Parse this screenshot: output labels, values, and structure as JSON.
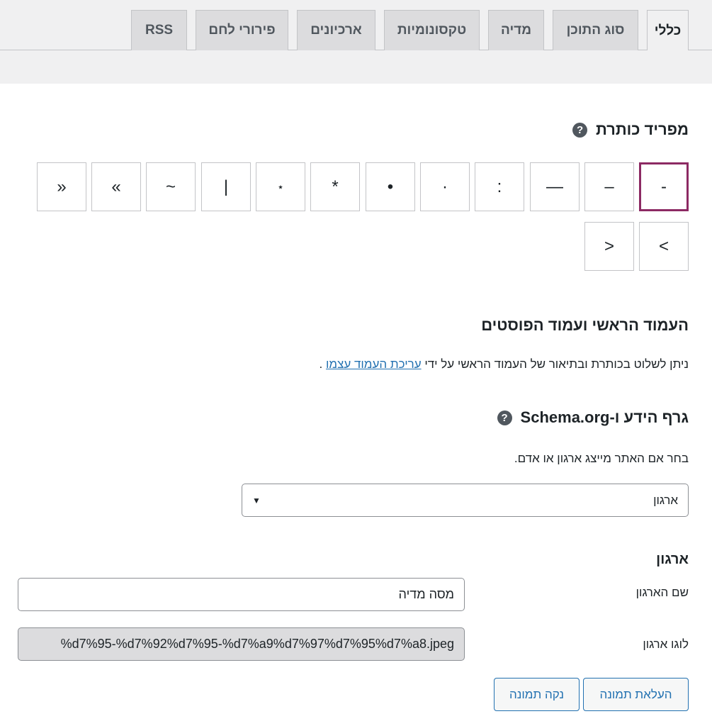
{
  "tabs": [
    {
      "label": "כללי",
      "active": true
    },
    {
      "label": "סוג התוכן",
      "active": false
    },
    {
      "label": "מדיה",
      "active": false
    },
    {
      "label": "טקסונומיות",
      "active": false
    },
    {
      "label": "ארכיונים",
      "active": false
    },
    {
      "label": "פירורי לחם",
      "active": false
    },
    {
      "label": "RSS",
      "active": false
    }
  ],
  "separator": {
    "title": "מפריד כותרת",
    "help_icon": "?",
    "options": [
      "-",
      "–",
      "—",
      ":",
      "·",
      "•",
      "*",
      "⋆",
      "|",
      "~",
      "»",
      "«",
      ">",
      "<"
    ],
    "selected": "-"
  },
  "homepage": {
    "title": "העמוד הראשי ועמוד הפוסטים",
    "desc_prefix": "ניתן לשלוט בכותרת ובתיאור של העמוד הראשי על ידי",
    "desc_link": "עריכת העמוד עצמו",
    "desc_suffix": "."
  },
  "schema": {
    "title": "גרף הידע ו-Schema.org",
    "help_icon": "?",
    "instruction": "בחר אם האתר מייצג ארגון או אדם.",
    "select_value": "ארגון",
    "select_caret": "▼"
  },
  "organization": {
    "title": "ארגון",
    "name_label": "שם הארגון",
    "name_value": "מסה מדיה",
    "logo_label": "לוגו ארגון",
    "logo_value": "%d7%95-%d7%92%d7%95-%d7%a9%d7%97%d7%95%d7%a8.jpeg"
  },
  "buttons": {
    "upload": "העלאת תמונה",
    "clear": "נקה תמונה"
  },
  "colors": {
    "accent": "#8c2a63",
    "link": "#2271b1",
    "help_icon_bg": "#50575e"
  }
}
